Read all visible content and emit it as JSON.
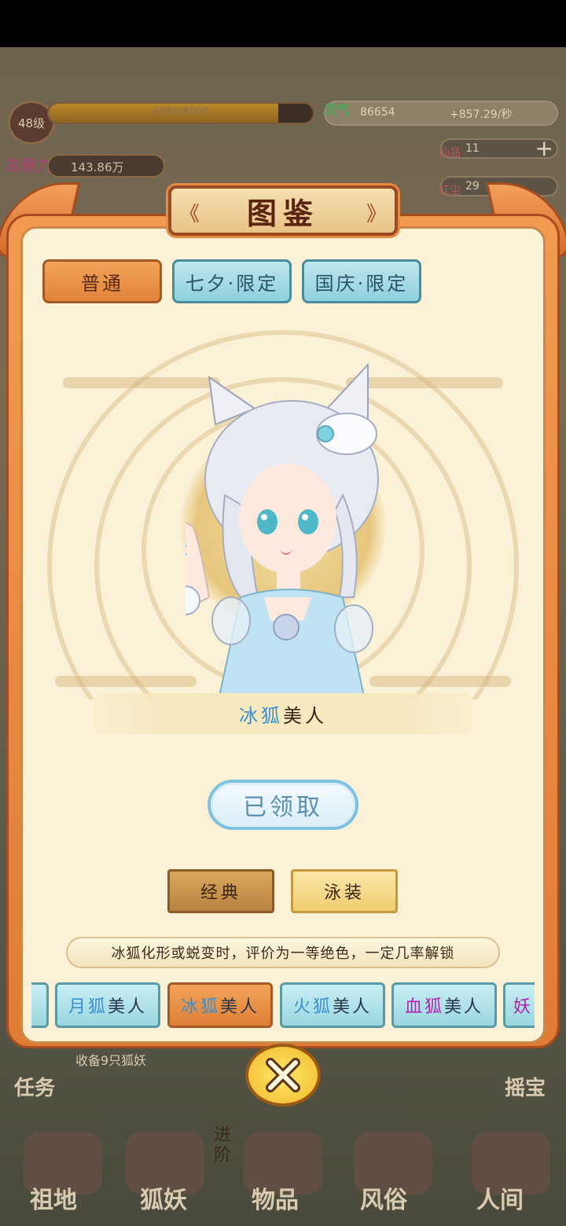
{
  "hud": {
    "level": "48级",
    "exp_text": "6989/8000",
    "exp_progress": 0.87,
    "lingqi_label": "灵气",
    "lingqi_value": "86654",
    "lingqi_rate": "+857.29/秒",
    "charm_label": "总魅力",
    "charm_value": "143.86万",
    "xianpin_label": "仙品",
    "xianpin_value": "11",
    "hongchen_label": "红尘",
    "hongchen_value": "29",
    "task_label": "任务",
    "advance_label": "进阶",
    "treasure_label": "摇宝",
    "task_progress_text": "收备9只狐妖"
  },
  "dialog": {
    "title": "图鉴",
    "category_tabs": [
      {
        "label": "普通",
        "active": true
      },
      {
        "label": "七夕·限定",
        "active": false
      },
      {
        "label": "国庆·限定",
        "active": false
      }
    ],
    "character_name_prefix": "冰狐",
    "character_name_suffix": "美人",
    "claim_button": "已领取",
    "skin_buttons": [
      "经典",
      "泳装"
    ],
    "description": "冰狐化形或蜕变时，评价为一等绝色，一定几率解锁",
    "character_tabs": [
      {
        "prefix": "月狐",
        "suffix": "美人",
        "active": false
      },
      {
        "prefix": "冰狐",
        "suffix": "美人",
        "active": true
      },
      {
        "prefix": "火狐",
        "suffix": "美人",
        "active": false
      },
      {
        "prefix": "血狐",
        "suffix": "美人",
        "active": false
      },
      {
        "prefix": "妖",
        "suffix": "",
        "active": false
      }
    ]
  },
  "bottom_nav": [
    "祖地",
    "狐妖",
    "物品",
    "风俗",
    "人间"
  ],
  "colors": {
    "frame_orange": "#e07b35",
    "inner_bg": "#fbf1d6",
    "tab_teal": "#9ad6df",
    "name_blue": "#3a8fd0",
    "name_purple": "#b020b0"
  }
}
